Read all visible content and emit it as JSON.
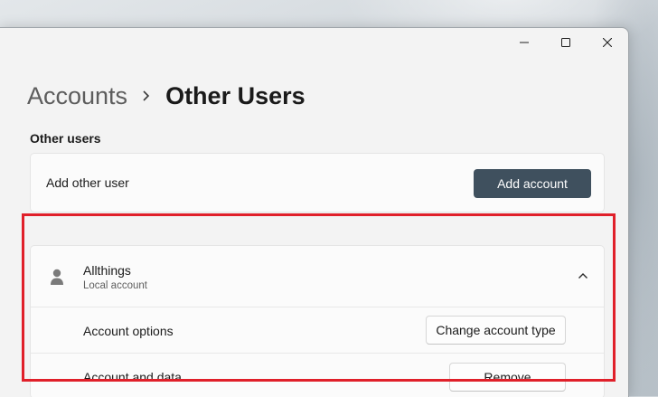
{
  "breadcrumb": {
    "parent": "Accounts",
    "current": "Other Users"
  },
  "section": {
    "title": "Other users"
  },
  "add_user": {
    "label": "Add other user",
    "button_label": "Add account"
  },
  "user": {
    "name": "Allthings",
    "type": "Local account",
    "expanded": true,
    "options": [
      {
        "label": "Account options",
        "button_label": "Change account type"
      },
      {
        "label": "Account and data",
        "button_label": "Remove"
      }
    ]
  },
  "icons": {
    "minimize": "minimize-icon",
    "maximize": "maximize-icon",
    "close": "close-icon",
    "breadcrumb_separator": "chevron-right-icon",
    "user": "person-icon",
    "collapse": "chevron-up-icon"
  },
  "colors": {
    "primary_button": "#3f505e",
    "highlight": "#e0202a",
    "window_background": "#f3f3f3"
  }
}
